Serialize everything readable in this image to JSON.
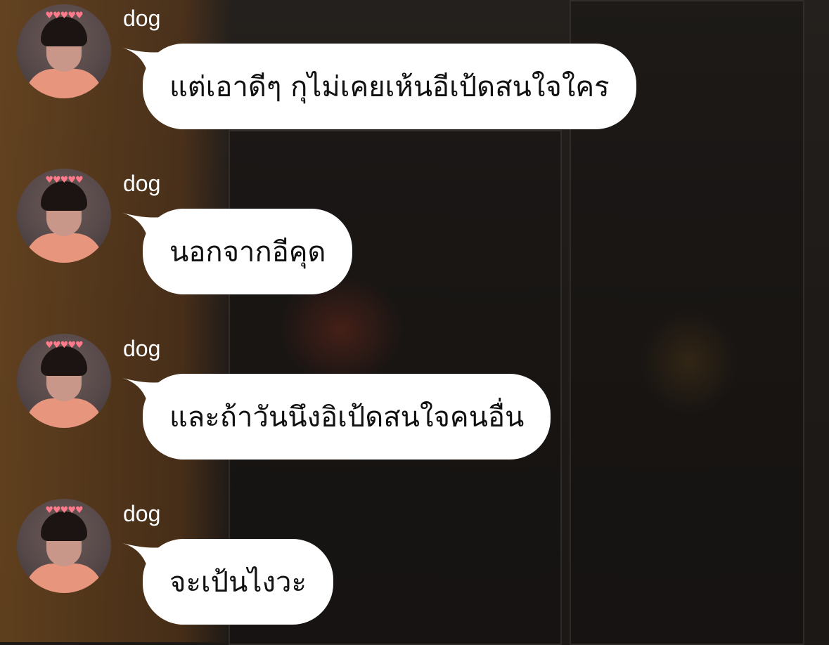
{
  "messages": [
    {
      "sender": "dog",
      "text": "แต่เอาดีๆ กุไม่เคยเห้นอีเป้ดสนใจใคร"
    },
    {
      "sender": "dog",
      "text": "นอกจากอีคุด"
    },
    {
      "sender": "dog",
      "text": "และถ้าวันนึงอิเป้ดสนใจคนอื่น"
    },
    {
      "sender": "dog",
      "text": "จะเป้นไงวะ"
    }
  ],
  "colors": {
    "bubble": "#ffffff",
    "bubble_text": "#111111",
    "sender_name": "#ffffff",
    "avatar_shirt": "#e8957d",
    "avatar_hearts": "#ff7a8a"
  },
  "icons": {
    "avatar_decoration": "heart-crown-icon"
  }
}
